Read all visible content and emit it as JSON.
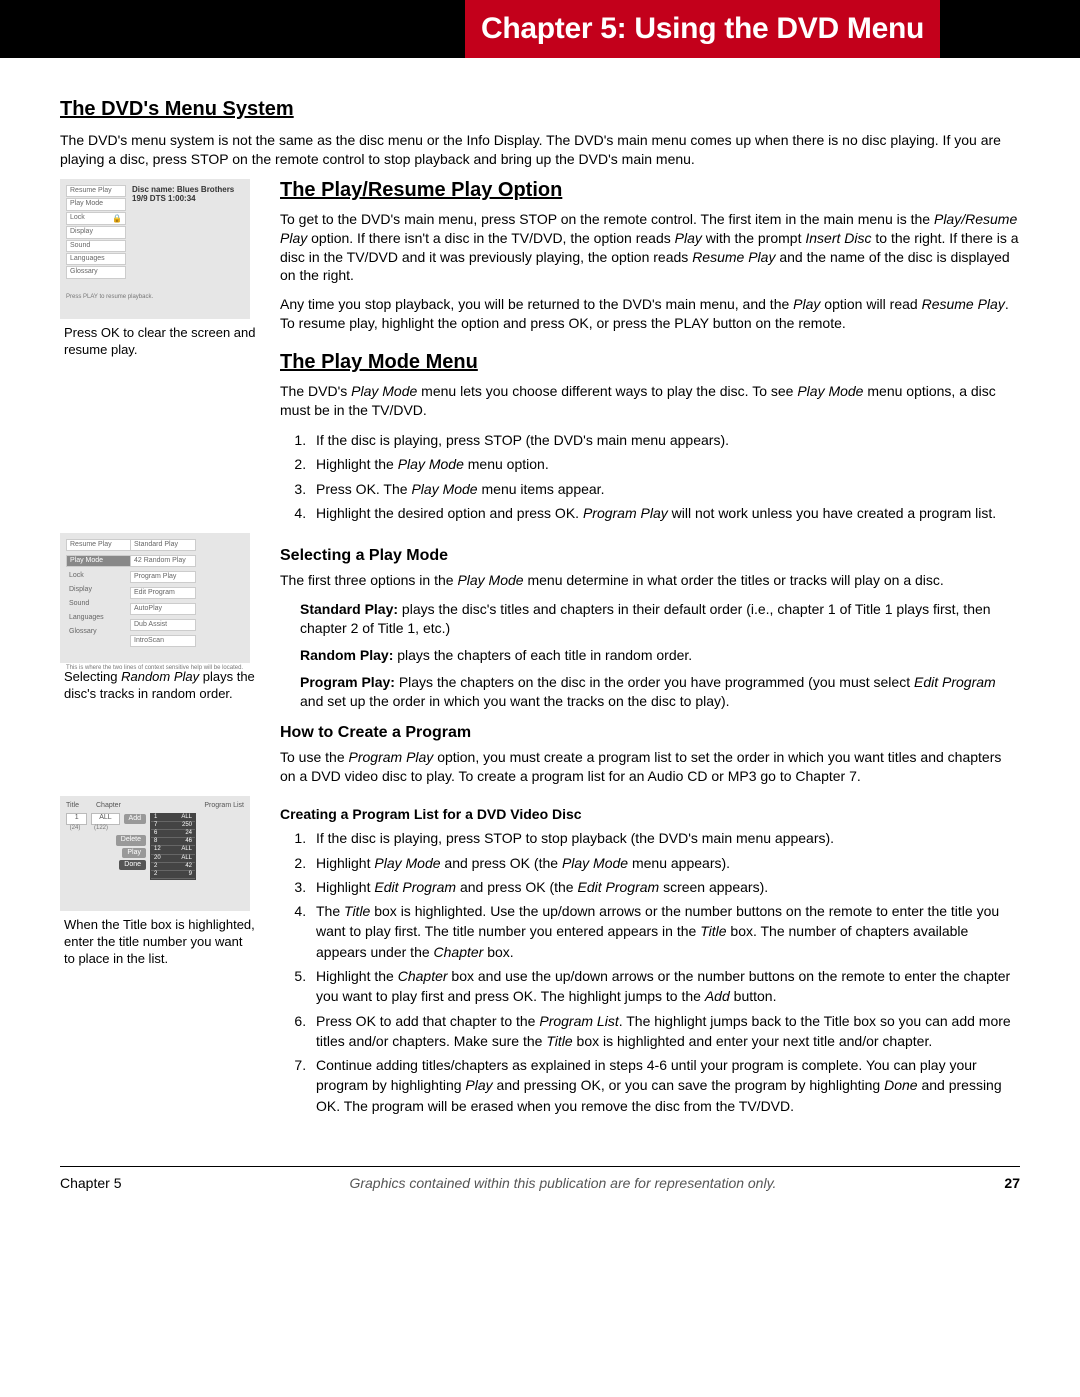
{
  "header": {
    "chapter_title": "Chapter 5: Using the DVD Menu"
  },
  "section1": {
    "heading": "The DVD's Menu System",
    "intro": "The DVD's menu system is not the same as the disc menu or the Info Display. The DVD's main menu comes up when there is no disc playing. If you are playing a disc, press STOP on the remote control to stop playback and bring up the DVD's main menu."
  },
  "fig1": {
    "menu": [
      "Resume Play",
      "Play Mode",
      "Lock",
      "Display",
      "Sound",
      "Languages",
      "Glossary"
    ],
    "info_line1": "Disc name: Blues Brothers",
    "info_line2": "19/9 DTS  1:00:34",
    "foot": "Press PLAY to resume playback.",
    "caption": "Press OK to clear the screen and resume play."
  },
  "section2": {
    "heading": "The Play/Resume Play Option",
    "p1_pre": "To get to the DVD's main menu, press STOP on the remote control. The first item in the main menu is the ",
    "p1_it1": "Play/Resume Play",
    "p1_mid1": " option. If there isn't a disc in the TV/DVD, the option reads ",
    "p1_it2": "Play",
    "p1_mid2": " with the prompt ",
    "p1_it3": "Insert Disc",
    "p1_mid3": " to the right. If there is a disc in the TV/DVD and it was previously playing, the option reads ",
    "p1_it4": "Resume Play",
    "p1_end": " and the name of the disc is displayed on the right.",
    "p2_pre": "Any time you stop playback, you will be returned to the DVD's main menu, and the ",
    "p2_it1": "Play",
    "p2_mid": " option will read ",
    "p2_it2": "Resume Play",
    "p2_end": ". To resume play, highlight the option and press OK, or press the PLAY button on the remote."
  },
  "section3": {
    "heading": "The Play Mode Menu",
    "p1_pre": "The DVD's ",
    "p1_it1": "Play Mode",
    "p1_mid": " menu lets you choose different ways to play the disc. To see ",
    "p1_it2": "Play Mode",
    "p1_end": " menu options, a disc must be in the TV/DVD.",
    "step1": "If the disc is playing, press STOP (the DVD's main menu appears).",
    "step2_pre": "Highlight the ",
    "step2_it": "Play Mode",
    "step2_end": " menu option.",
    "step3_pre": "Press OK. The ",
    "step3_it": "Play Mode",
    "step3_end": " menu items appear.",
    "step4_pre": "Highlight the desired option and press OK. ",
    "step4_it": "Program Play",
    "step4_end": " will not work unless you have created a program list."
  },
  "fig2": {
    "left_menu": [
      "Resume Play",
      "Play Mode",
      "Lock",
      "Display",
      "Sound",
      "Languages",
      "Glossary"
    ],
    "right_menu": [
      "Standard Play",
      "Random Play",
      "Program Play",
      "Edit Program",
      "AutoPlay",
      "Dub Assist",
      "IntroScan"
    ],
    "random_prefix": "42",
    "foot": "This is where the two lines of context sensitive help will be located.",
    "caption_pre": "Selecting ",
    "caption_it": "Random Play",
    "caption_end": " plays the disc's tracks in random order."
  },
  "section4": {
    "heading": "Selecting a Play Mode",
    "p1_pre": "The first three options in the ",
    "p1_it": "Play Mode",
    "p1_end": " menu determine in what order the titles or tracks will play on a disc.",
    "std_label": "Standard Play:",
    "std_text": " plays the disc's titles and chapters in their default order (i.e., chapter 1 of Title 1 plays first, then chapter 2 of Title 1, etc.)",
    "rnd_label": "Random Play:",
    "rnd_text": " plays the chapters of each title in random order.",
    "prg_label": "Program Play:",
    "prg_text_pre": "  Plays the chapters on the disc in the order you have programmed (you must select ",
    "prg_it": "Edit Program",
    "prg_text_end": " and set up the order in which you want the tracks on the disc to play)."
  },
  "section5": {
    "heading": "How to Create a Program",
    "p1_pre": "To use the ",
    "p1_it": "Program Play",
    "p1_end": " option, you must create a program list to set the order in which you want titles and chapters on a DVD video disc to play. To create a program list for an Audio CD or MP3 go to Chapter 7.",
    "subheading": "Creating a Program List for a DVD Video Disc",
    "s1": "If the disc is playing, press STOP to stop playback (the DVD's main menu appears).",
    "s2_pre": "Highlight ",
    "s2_it1": "Play Mode",
    "s2_mid": " and press OK (the ",
    "s2_it2": "Play Mode",
    "s2_end": " menu appears).",
    "s3_pre": "Highlight ",
    "s3_it1": "Edit Program",
    "s3_mid": " and press OK (the ",
    "s3_it2": "Edit Program",
    "s3_end": " screen appears).",
    "s4_pre": "The ",
    "s4_it1": "Title",
    "s4_mid1": " box is highlighted. Use the up/down arrows or the number buttons on the remote to enter the title you want to play first. The title number you entered appears in the ",
    "s4_it2": "Title",
    "s4_mid2": " box. The number of chapters available appears under the ",
    "s4_it3": "Chapter",
    "s4_end": " box.",
    "s5_pre": "Highlight the ",
    "s5_it1": "Chapter",
    "s5_mid": " box and use the up/down arrows or the number buttons on the remote to enter the chapter you want to play first and press OK. The highlight jumps to the ",
    "s5_it2": "Add",
    "s5_end": " button.",
    "s6_pre": "Press OK to add that chapter to the ",
    "s6_it1": "Program List",
    "s6_mid": ". The highlight jumps back to the Title box so you can add more titles and/or chapters. Make sure the ",
    "s6_it2": "Title",
    "s6_end": " box is highlighted and enter your next title and/or chapter.",
    "s7_pre": "Continue adding titles/chapters as explained in steps 4-6 until your program is complete. You can play your program by highlighting ",
    "s7_it1": "Play",
    "s7_mid": " and pressing OK, or you can save the program by highlighting ",
    "s7_it2": "Done",
    "s7_end": " and pressing OK. The program will be erased when you remove the disc from the TV/DVD."
  },
  "fig3": {
    "title_lbl": "Title",
    "chapter_lbl": "Chapter",
    "prog_lbl": "Program List",
    "title_box": "1",
    "ch_box": "ALL",
    "count_l": "(24)",
    "count_r": "(122)",
    "btn_add": "Add",
    "btn_delete": "Delete",
    "btn_play": "Play",
    "btn_done": "Done",
    "rows": [
      [
        "1",
        "ALL"
      ],
      [
        "7",
        "250"
      ],
      [
        "6",
        "24"
      ],
      [
        "8",
        "46"
      ],
      [
        "12",
        "ALL"
      ],
      [
        "20",
        "ALL"
      ],
      [
        "2",
        "42"
      ],
      [
        "2",
        "9"
      ]
    ],
    "caption": "When the Title box is highlighted, enter the title number you want to place in the list."
  },
  "footer": {
    "left": "Chapter 5",
    "center": "Graphics contained within this publication are for representation only.",
    "right": "27"
  }
}
